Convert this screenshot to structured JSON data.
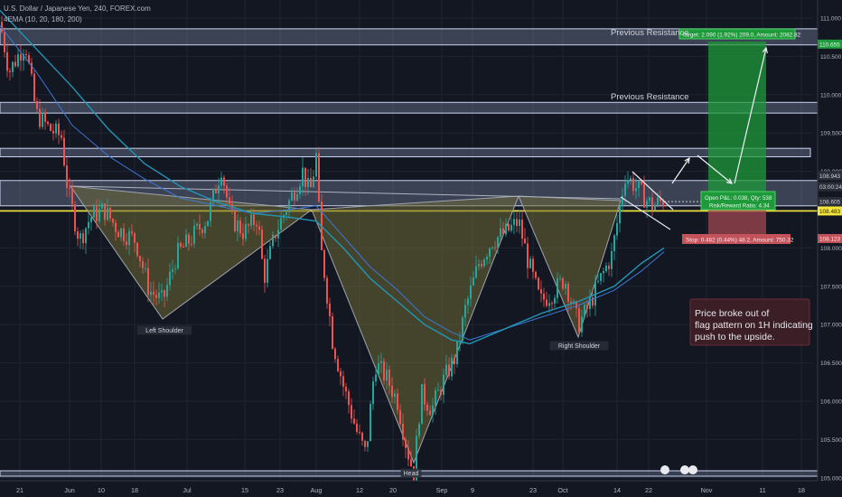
{
  "header": {
    "symbol": "U.S. Dollar / Japanese Yen, 240, FOREX.com",
    "indicator": "4EMA (10, 20, 180, 200)"
  },
  "colors": {
    "background": "#131722",
    "up_candle": "#26a69a",
    "down_candle": "#ef5350",
    "ema_slow": "#2196b6",
    "neckline_yellow": "#f5e63a",
    "zone_fill": "#a5b4d8",
    "target_box": "#1f9a3a",
    "stop_box": "#a84a52",
    "pattern_fill": "#6d6a36",
    "note_bg": "#3b1e26"
  },
  "annotations": {
    "resistance_1": "Previous Resistance",
    "resistance_2": "Previous Resistance",
    "left_shoulder": "Left Shoulder",
    "head": "Head",
    "right_shoulder": "Right Shoulder",
    "note_lines": [
      "Price broke out of",
      "flag pattern on 1H indicating",
      "push to the upside."
    ],
    "target": "Target: 2.090 (1.92%) 209.0, Amount: 2082.82",
    "open_pl": "Open P&L: 0.038, Qty: 538",
    "risk_reward": "Risk/Reward Ratio: 4.34",
    "stop": "Stop: 0.482 (0.44%) 48.2, Amount: 750.32"
  },
  "chart_data": {
    "type": "candlestick",
    "y_ticks": [
      "111.000",
      "110.500",
      "110.000",
      "109.500",
      "109.000",
      "108.500",
      "108.000",
      "107.500",
      "107.000",
      "106.500",
      "106.000",
      "105.500",
      "105.000"
    ],
    "y_range": [
      104.93,
      111.15
    ],
    "x_ticks": [
      "21",
      "Jun",
      "10",
      "18",
      "Jul",
      "15",
      "23",
      "Aug",
      "12",
      "20",
      "Sep",
      "9",
      "23",
      "Oct",
      "14",
      "22",
      "Nov",
      "11",
      "18"
    ],
    "price_labels": {
      "last": "108.943",
      "countdown": "03:00:24",
      "entry": "108.605",
      "yellow": "108.483",
      "stop": "108.123",
      "target": "110.655"
    },
    "levels": {
      "resistance_1": [
        110.65,
        110.86
      ],
      "resistance_2": [
        109.76,
        109.9
      ],
      "resistance_3": [
        109.19,
        109.3
      ],
      "neck_zone": [
        108.55,
        108.88
      ],
      "entry": 108.605,
      "stop": 108.123,
      "target": 110.695
    },
    "grid": true,
    "legend": "none"
  }
}
